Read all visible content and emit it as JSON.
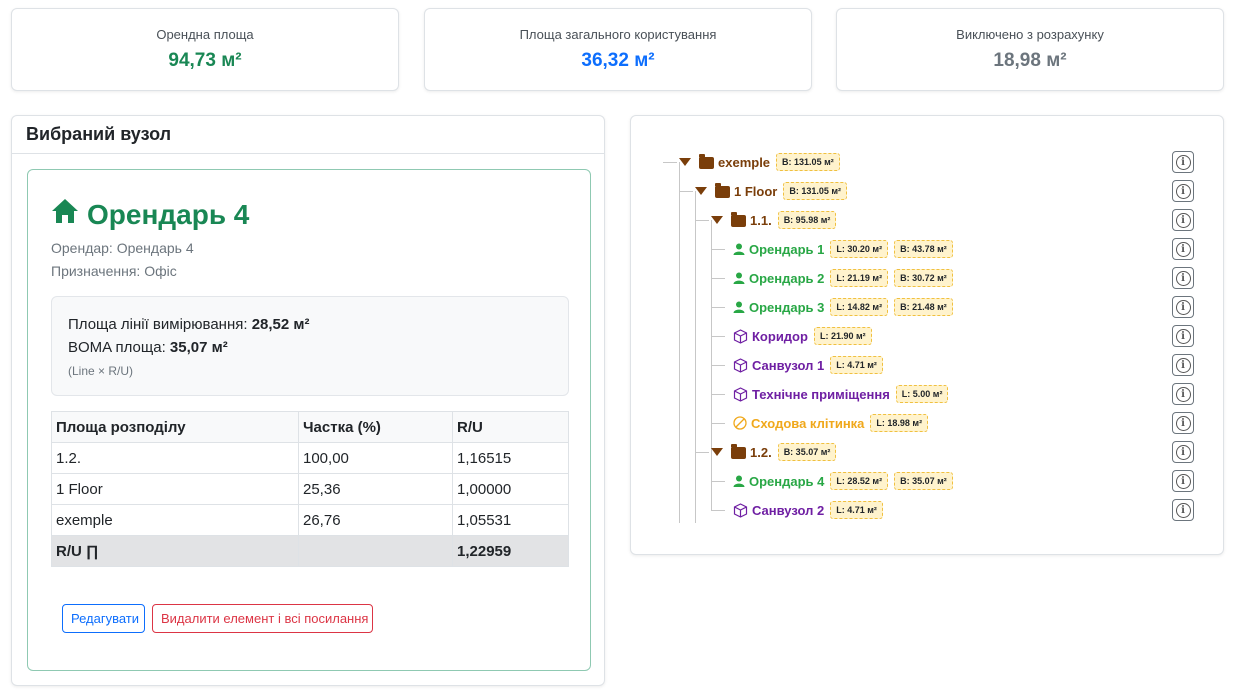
{
  "stats": [
    {
      "label": "Орендна площа",
      "value": "94,73 м²",
      "color": "#198754"
    },
    {
      "label": "Площа загального користування",
      "value": "36,32 м²",
      "color": "#0d6efd"
    },
    {
      "label": "Виключено з розрахунку",
      "value": "18,98 м²",
      "color": "#6c757d"
    }
  ],
  "selected": {
    "header": "Вибраний вузол",
    "title": "Орендарь 4",
    "title_icon": "home-icon",
    "tenant_label": "Орендар:",
    "tenant_value": "Орендарь 4",
    "purpose_label": "Призначення:",
    "purpose_value": "Офіс",
    "line_area_label": "Площа лінії вимірювання:",
    "line_area_value": "28,52 м²",
    "boma_label": "BOMA площа:",
    "boma_value": "35,07 м²",
    "formula_note": "(Line × R/U)",
    "table": {
      "headers": [
        "Площа розподілу",
        "Частка (%)",
        "R/U"
      ],
      "rows": [
        [
          "1.2.",
          "100,00",
          "1,16515"
        ],
        [
          "1 Floor",
          "25,36",
          "1,00000"
        ],
        [
          "exemple",
          "26,76",
          "1,05531"
        ]
      ],
      "total": [
        "R/U ∏",
        "",
        "1,22959"
      ]
    },
    "edit_label": "Редагувати",
    "delete_label": "Видалити елемент і всі посилання"
  },
  "tree": [
    {
      "name": "exemple",
      "type": "folder",
      "depth": 0,
      "badges": [
        "B: 131.05 м²"
      ]
    },
    {
      "name": "1 Floor",
      "type": "folder",
      "depth": 1,
      "badges": [
        "B: 131.05 м²"
      ]
    },
    {
      "name": "1.1.",
      "type": "folder",
      "depth": 2,
      "badges": [
        "B: 95.98 м²"
      ]
    },
    {
      "name": "Орендарь 1",
      "type": "tenant",
      "depth": 3,
      "badges": [
        "L: 30.20 м²",
        "B: 43.78 м²"
      ]
    },
    {
      "name": "Орендарь 2",
      "type": "tenant",
      "depth": 3,
      "badges": [
        "L: 21.19 м²",
        "B: 30.72 м²"
      ]
    },
    {
      "name": "Орендарь 3",
      "type": "tenant",
      "depth": 3,
      "badges": [
        "L: 14.82 м²",
        "B: 21.48 м²"
      ]
    },
    {
      "name": "Коридор",
      "type": "room",
      "depth": 3,
      "badges": [
        "L: 21.90 м²"
      ]
    },
    {
      "name": "Санвузол 1",
      "type": "room",
      "depth": 3,
      "badges": [
        "L: 4.71 м²"
      ]
    },
    {
      "name": "Технічне приміщення",
      "type": "room",
      "depth": 3,
      "badges": [
        "L: 5.00 м²"
      ]
    },
    {
      "name": "Сходова клітинка",
      "type": "stair",
      "depth": 3,
      "badges": [
        "L: 18.98 м²"
      ]
    },
    {
      "name": "1.2.",
      "type": "folder",
      "depth": 2,
      "badges": [
        "B: 35.07 м²"
      ]
    },
    {
      "name": "Орендарь 4",
      "type": "tenant",
      "depth": 3,
      "badges": [
        "L: 28.52 м²",
        "B: 35.07 м²"
      ]
    },
    {
      "name": "Санвузол 2",
      "type": "room",
      "depth": 3,
      "badges": [
        "L: 4.71 м²"
      ]
    }
  ],
  "info_icon": "info-icon",
  "colors": {
    "folder": "#7a3e0a",
    "tenant": "#28a745",
    "room": "#6f1fa3",
    "stair": "#f0a81b"
  }
}
